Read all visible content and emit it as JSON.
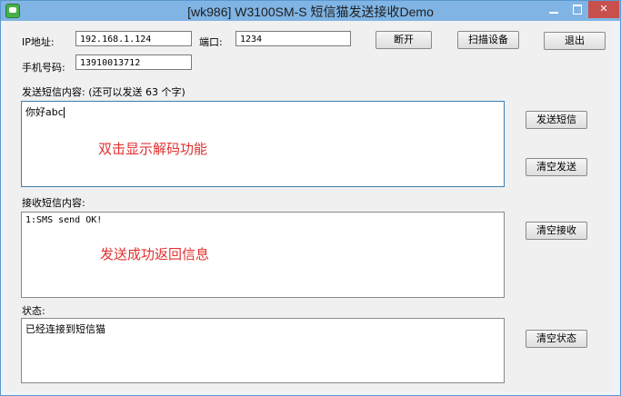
{
  "window": {
    "title": "[wk986] W3100SM-S 短信猫发送接收Demo",
    "close_glyph": "✕",
    "accent": "#7fb4e4",
    "close_color": "#c7504c"
  },
  "connection": {
    "ip_label": "IP地址:",
    "ip_value": "192.168.1.124",
    "port_label": "端口:",
    "port_value": "1234",
    "phone_label": "手机号码:",
    "phone_value": "13910013712"
  },
  "buttons": {
    "disconnect": "断开",
    "scan": "扫描设备",
    "exit": "退出",
    "send_sms": "发送短信",
    "clear_send": "清空发送",
    "clear_receive": "清空接收",
    "clear_status": "清空状态"
  },
  "send": {
    "label": "发送短信内容: (还可以发送 63 个字)",
    "content": "你好abc",
    "annotation": "双击显示解码功能"
  },
  "receive": {
    "label": "接收短信内容:",
    "content": "1:SMS send OK!",
    "annotation": "发送成功返回信息"
  },
  "status": {
    "label": "状态:",
    "content": "已经连接到短信猫"
  }
}
